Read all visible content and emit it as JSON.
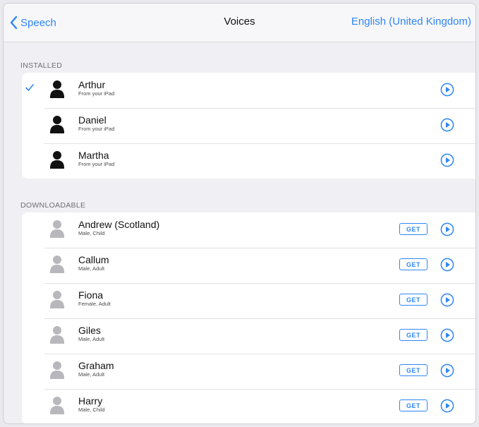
{
  "nav": {
    "back_label": "Speech",
    "title": "Voices",
    "language": "English (United Kingdom)"
  },
  "installed": {
    "header": "INSTALLED",
    "items": [
      {
        "name": "Arthur",
        "sub": "From your iPad",
        "selected": true
      },
      {
        "name": "Daniel",
        "sub": "From your iPad",
        "selected": false
      },
      {
        "name": "Martha",
        "sub": "From your iPad",
        "selected": false
      }
    ]
  },
  "downloadable": {
    "header": "DOWNLOADABLE",
    "get_label": "GET",
    "items": [
      {
        "name": "Andrew (Scotland)",
        "sub": "Male, Child"
      },
      {
        "name": "Callum",
        "sub": "Male, Adult"
      },
      {
        "name": "Fiona",
        "sub": "Female, Adult"
      },
      {
        "name": "Giles",
        "sub": "Male, Adult"
      },
      {
        "name": "Graham",
        "sub": "Male, Adult"
      },
      {
        "name": "Harry",
        "sub": "Male, Child"
      }
    ]
  },
  "colors": {
    "accent": "#2f86f6",
    "installed_avatar": "#111111",
    "downloadable_avatar": "#b8b8bc"
  },
  "icons": {
    "back": "chevron-left-icon",
    "check": "checkmark-icon",
    "avatar": "person-silhouette-icon",
    "play": "play-circle-icon"
  }
}
